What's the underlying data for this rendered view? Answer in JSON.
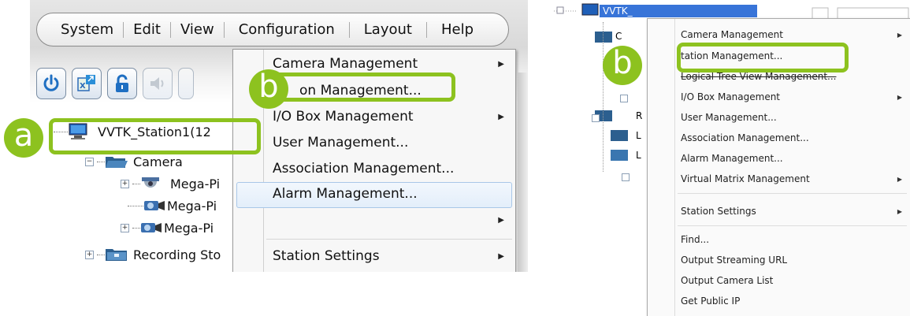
{
  "left_panel": {
    "menu_bar": [
      "System",
      "Edit",
      "View",
      "Configuration",
      "Layout",
      "Help"
    ],
    "toolbar_icons": [
      "power-icon",
      "export-icon",
      "unlock-icon",
      "speaker-icon"
    ],
    "tree": {
      "station": "VVTK_Station1(12",
      "camera_group": "Camera",
      "cameras": [
        "Mega-Pi",
        "Mega-Pi",
        "Mega-Pi"
      ],
      "recording": "Recording Sto"
    },
    "context_menu": {
      "items": [
        {
          "label": "Camera Management",
          "submenu": true
        },
        {
          "label": "on Management...",
          "submenu": false
        },
        {
          "label": "I/O Box Management",
          "submenu": true
        },
        {
          "label": "User Management...",
          "submenu": false
        },
        {
          "label": "Association Management...",
          "submenu": false
        },
        {
          "label": "Alarm Management...",
          "submenu": false
        },
        {
          "label": "",
          "submenu": true
        },
        {
          "label": "Station Settings",
          "submenu": true
        }
      ]
    },
    "badges": {
      "a": "a",
      "b": "b"
    }
  },
  "right_panel": {
    "tree_station": "VVTK_",
    "tree_letters": [
      "C",
      "R",
      "L",
      "L"
    ],
    "context_menu": {
      "items": [
        {
          "label": "Camera Management",
          "submenu": true
        },
        {
          "label": "tation Management...",
          "submenu": false
        },
        {
          "label": "Logical Tree View Management...",
          "submenu": false
        },
        {
          "label": "I/O Box Management",
          "submenu": true
        },
        {
          "label": "User Management...",
          "submenu": false
        },
        {
          "label": "Association Management...",
          "submenu": false
        },
        {
          "label": "Alarm Management...",
          "submenu": false
        },
        {
          "label": "Virtual Matrix Management",
          "submenu": true
        },
        {
          "label": "Station Settings",
          "submenu": true
        },
        {
          "label": "Find...",
          "submenu": false
        },
        {
          "label": "Output Streaming URL",
          "submenu": false
        },
        {
          "label": "Output Camera List",
          "submenu": false
        },
        {
          "label": "Get Public IP",
          "submenu": false
        }
      ]
    },
    "badge": "b"
  },
  "colors": {
    "highlight_green": "#8dc21f",
    "menu_hover": "#e3eefa",
    "selection_blue": "#3874d8"
  }
}
